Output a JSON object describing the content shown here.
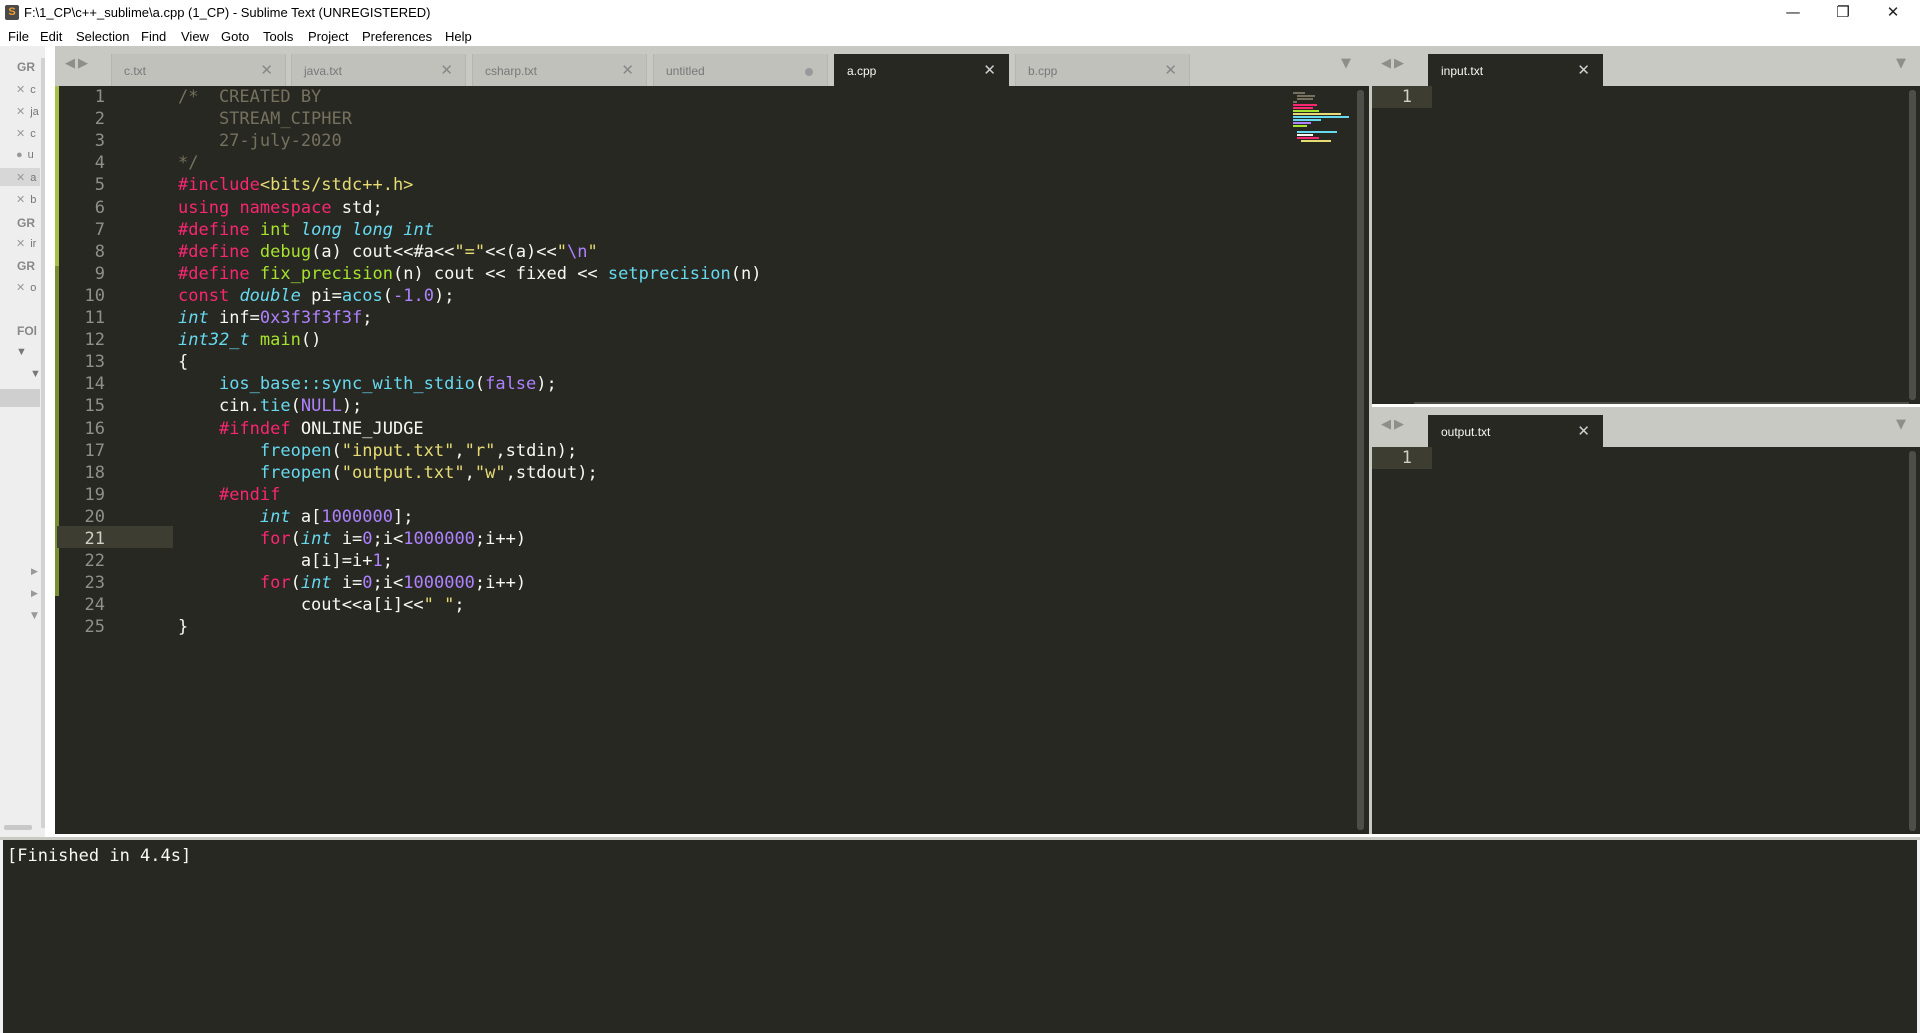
{
  "window": {
    "title": "F:\\1_CP\\c++_sublime\\a.cpp (1_CP) - Sublime Text (UNREGISTERED)",
    "minimize": "—",
    "restore": "❐",
    "close": "✕"
  },
  "menu": [
    "File",
    "Edit",
    "Selection",
    "Find",
    "View",
    "Goto",
    "Tools",
    "Project",
    "Preferences",
    "Help"
  ],
  "sidebar": {
    "group1": "GR",
    "files1": [
      "c",
      "ja",
      "c",
      "u",
      "a",
      "b"
    ],
    "group2": "GR",
    "files2": [
      "ir"
    ],
    "group3": "GR",
    "files3": [
      "o"
    ],
    "folders": "FOl"
  },
  "main_tabs": [
    {
      "label": "c.txt",
      "state": "close"
    },
    {
      "label": "java.txt",
      "state": "close"
    },
    {
      "label": "csharp.txt",
      "state": "close"
    },
    {
      "label": "untitled",
      "state": "dirty"
    },
    {
      "label": "a.cpp",
      "state": "close",
      "active": true
    },
    {
      "label": "b.cpp",
      "state": "close"
    }
  ],
  "tab_icons": {
    "close": "✕",
    "prev": "◀",
    "next": "▶",
    "dropdown": "▼"
  },
  "input_pane": {
    "tab": "input.txt",
    "line": "1"
  },
  "output_pane": {
    "tab": "output.txt",
    "line": "1"
  },
  "editor": {
    "current_line": 21,
    "line_numbers": [
      "1",
      "2",
      "3",
      "4",
      "5",
      "6",
      "7",
      "8",
      "9",
      "10",
      "11",
      "12",
      "13",
      "14",
      "15",
      "16",
      "17",
      "18",
      "19",
      "20",
      "21",
      "22",
      "23",
      "24",
      "25"
    ],
    "lines": [
      [
        [
          "c-comment",
          "/*  CREATED BY"
        ]
      ],
      [
        [
          "c-comment",
          "    STREAM_CIPHER"
        ]
      ],
      [
        [
          "c-comment",
          "    27-july-2020"
        ]
      ],
      [
        [
          "c-comment",
          "*/"
        ]
      ],
      [
        [
          "c-kw",
          "#include"
        ],
        [
          "c-str",
          "<bits/stdc++.h>"
        ]
      ],
      [
        [
          "c-kw",
          "using"
        ],
        [
          "c-plain",
          " "
        ],
        [
          "c-kw",
          "namespace"
        ],
        [
          "c-plain",
          " std;"
        ]
      ],
      [
        [
          "c-kw",
          "#define"
        ],
        [
          "c-plain",
          " "
        ],
        [
          "c-fn",
          "int"
        ],
        [
          "c-plain",
          " "
        ],
        [
          "c-type",
          "long long int"
        ]
      ],
      [
        [
          "c-kw",
          "#define"
        ],
        [
          "c-plain",
          " "
        ],
        [
          "c-fn",
          "debug"
        ],
        [
          "c-plain",
          "(a) cout<<#a<<"
        ],
        [
          "c-str",
          "\"=\""
        ],
        [
          "c-plain",
          "<<(a)<<"
        ],
        [
          "c-str",
          "\""
        ],
        [
          "c-num",
          "\\n"
        ],
        [
          "c-str",
          "\""
        ]
      ],
      [
        [
          "c-kw",
          "#define"
        ],
        [
          "c-plain",
          " "
        ],
        [
          "c-fn",
          "fix_precision"
        ],
        [
          "c-plain",
          "(n) cout << fixed << "
        ],
        [
          "c-sup",
          "setprecision"
        ],
        [
          "c-plain",
          "(n)"
        ]
      ],
      [
        [
          "c-kw",
          "const"
        ],
        [
          "c-plain",
          " "
        ],
        [
          "c-type",
          "double"
        ],
        [
          "c-plain",
          " pi="
        ],
        [
          "c-sup",
          "acos"
        ],
        [
          "c-plain",
          "("
        ],
        [
          "c-num",
          "-1.0"
        ],
        [
          "c-plain",
          ");"
        ]
      ],
      [
        [
          "c-type",
          "int"
        ],
        [
          "c-plain",
          " inf="
        ],
        [
          "c-num",
          "0x3f3f3f3f"
        ],
        [
          "c-plain",
          ";"
        ]
      ],
      [
        [
          "c-type",
          "int32_t"
        ],
        [
          "c-plain",
          " "
        ],
        [
          "c-fn",
          "main"
        ],
        [
          "c-plain",
          "()"
        ]
      ],
      [
        [
          "c-plain",
          "{"
        ]
      ],
      [
        [
          "c-plain",
          "    "
        ],
        [
          "c-sup",
          "ios_base::sync_with_stdio"
        ],
        [
          "c-plain",
          "("
        ],
        [
          "c-num",
          "false"
        ],
        [
          "c-plain",
          ");"
        ]
      ],
      [
        [
          "c-plain",
          "    cin."
        ],
        [
          "c-sup",
          "tie"
        ],
        [
          "c-plain",
          "("
        ],
        [
          "c-num",
          "NULL"
        ],
        [
          "c-plain",
          ");"
        ]
      ],
      [
        [
          "c-plain",
          "    "
        ],
        [
          "c-kw",
          "#ifndef"
        ],
        [
          "c-plain",
          " ONLINE_JUDGE"
        ]
      ],
      [
        [
          "c-plain",
          "        "
        ],
        [
          "c-sup",
          "freopen"
        ],
        [
          "c-plain",
          "("
        ],
        [
          "c-str",
          "\"input.txt\""
        ],
        [
          "c-plain",
          ","
        ],
        [
          "c-str",
          "\"r\""
        ],
        [
          "c-plain",
          ",stdin);"
        ]
      ],
      [
        [
          "c-plain",
          "        "
        ],
        [
          "c-sup",
          "freopen"
        ],
        [
          "c-plain",
          "("
        ],
        [
          "c-str",
          "\"output.txt\""
        ],
        [
          "c-plain",
          ","
        ],
        [
          "c-str",
          "\"w\""
        ],
        [
          "c-plain",
          ",stdout);"
        ]
      ],
      [
        [
          "c-plain",
          "    "
        ],
        [
          "c-kw",
          "#endif"
        ]
      ],
      [
        [
          "c-plain",
          "        "
        ],
        [
          "c-type",
          "int"
        ],
        [
          "c-plain",
          " a["
        ],
        [
          "c-num",
          "1000000"
        ],
        [
          "c-plain",
          "];"
        ]
      ],
      [
        [
          "c-plain",
          "        "
        ],
        [
          "c-kw",
          "for"
        ],
        [
          "c-plain",
          "("
        ],
        [
          "c-type",
          "int"
        ],
        [
          "c-plain",
          " i="
        ],
        [
          "c-num",
          "0"
        ],
        [
          "c-plain",
          ";i<"
        ],
        [
          "c-num",
          "1000000"
        ],
        [
          "c-plain",
          ";i++)"
        ]
      ],
      [
        [
          "c-plain",
          "            a[i]=i+"
        ],
        [
          "c-num",
          "1"
        ],
        [
          "c-plain",
          ";"
        ]
      ],
      [
        [
          "c-plain",
          "        "
        ],
        [
          "c-kw",
          "for"
        ],
        [
          "c-plain",
          "("
        ],
        [
          "c-type",
          "int"
        ],
        [
          "c-plain",
          " i="
        ],
        [
          "c-num",
          "0"
        ],
        [
          "c-plain",
          ";i<"
        ],
        [
          "c-num",
          "1000000"
        ],
        [
          "c-plain",
          ";i++)"
        ]
      ],
      [
        [
          "c-plain",
          "            cout<<a[i]<<"
        ],
        [
          "c-str",
          "\" \""
        ],
        [
          "c-plain",
          ";"
        ]
      ],
      [
        [
          "c-plain",
          "}"
        ]
      ]
    ]
  },
  "build_output": "[Finished in 4.4s]"
}
